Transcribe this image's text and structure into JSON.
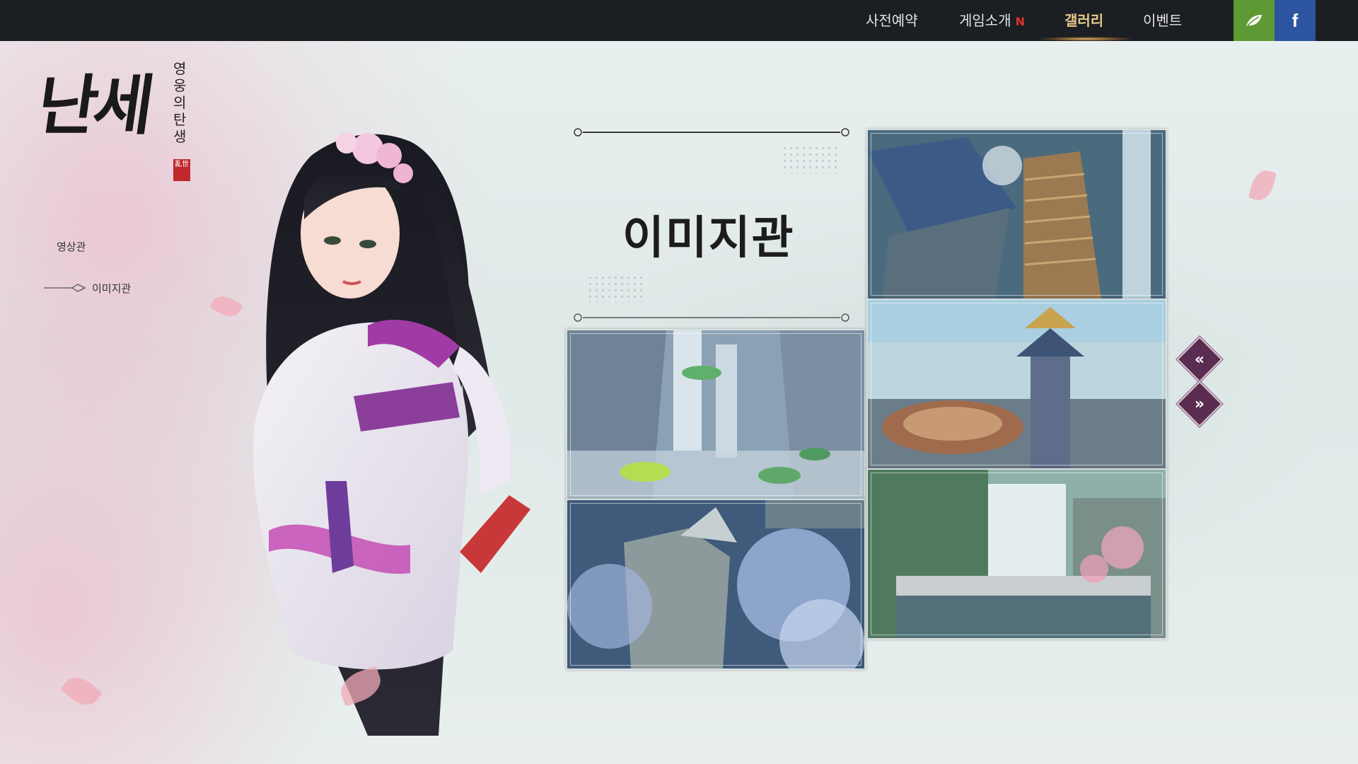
{
  "nav": {
    "items": [
      {
        "label": "사전예약"
      },
      {
        "label": "게임소개",
        "badge": "N"
      },
      {
        "label": "갤러리"
      },
      {
        "label": "이벤트"
      }
    ],
    "active": "갤러리"
  },
  "social": {
    "leaf_icon": "leaf-icon",
    "facebook_glyph": "f"
  },
  "logo": {
    "main": "난세",
    "sub": "영웅의탄생",
    "seal": "亂世"
  },
  "sidebar": {
    "items": [
      {
        "label": "영상관"
      },
      {
        "label": "이미지관"
      }
    ],
    "active": "이미지관"
  },
  "gallery": {
    "title": "이미지관",
    "thumbnails": [
      {
        "name": "waterfall-lotus-cliff"
      },
      {
        "name": "blossom-rock-garden"
      },
      {
        "name": "wooden-rooftop-stairs"
      },
      {
        "name": "lakeside-pagoda-terrace"
      },
      {
        "name": "bamboo-waterfall-bridge"
      }
    ],
    "prev_arrow": "«",
    "next_arrow": "»"
  },
  "colors": {
    "topbar": "#1b1e22",
    "nav_active": "#e8c88a",
    "badge": "#e0312c",
    "leaf_button": "#5e9a33",
    "facebook_button": "#2d54a0",
    "arrow": "#5b2c52"
  }
}
